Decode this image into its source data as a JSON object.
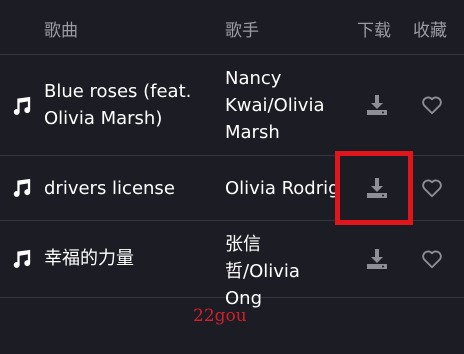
{
  "header": {
    "song": "歌曲",
    "artist": "歌手",
    "download": "下载",
    "favorite": "收藏"
  },
  "songs": [
    {
      "title": "Blue roses (feat. Olivia Marsh)",
      "artist": "Nancy Kwai/Olivia Marsh"
    },
    {
      "title": "drivers license",
      "artist": "Olivia Rodrigo"
    },
    {
      "title": "幸福的力量",
      "artist": "张信哲/Olivia Ong"
    }
  ],
  "icons": {
    "note": "music-note-icon",
    "download": "download-icon",
    "favorite": "heart-icon"
  },
  "colors": {
    "background": "#1b1c24",
    "header_text": "#9a9ba3",
    "icon": "#8d8e96",
    "highlight": "#e0161c"
  },
  "watermark": "22gou"
}
